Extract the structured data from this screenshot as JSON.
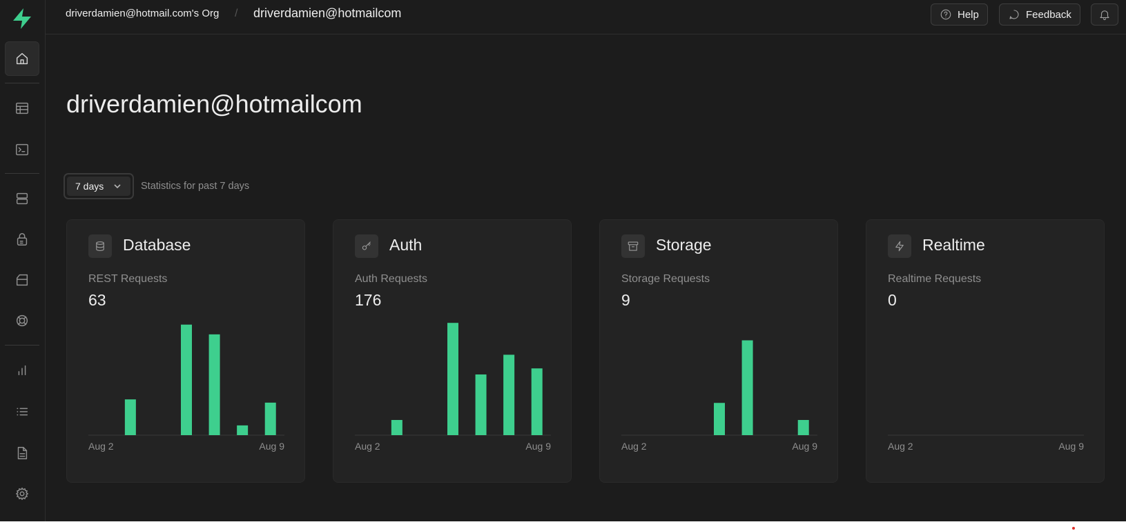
{
  "org": {
    "name": "driverdamien@hotmail.com's Org"
  },
  "project": {
    "name": "driverdamien@hotmailcom"
  },
  "header": {
    "separator": "/",
    "help_label": "Help",
    "feedback_label": "Feedback"
  },
  "sidebar": {
    "items": [
      {
        "name": "home",
        "icon": "home-icon"
      },
      {
        "name": "table-editor",
        "icon": "table-icon"
      },
      {
        "name": "sql-editor",
        "icon": "terminal-icon"
      },
      {
        "name": "database",
        "icon": "database-icon"
      },
      {
        "name": "authentication",
        "icon": "lock-icon"
      },
      {
        "name": "storage",
        "icon": "archive-icon"
      },
      {
        "name": "realtime",
        "icon": "realtime-icon"
      },
      {
        "name": "reports",
        "icon": "bar-chart-icon"
      },
      {
        "name": "logs",
        "icon": "list-icon"
      },
      {
        "name": "api-docs",
        "icon": "document-icon"
      },
      {
        "name": "settings",
        "icon": "gear-icon"
      }
    ]
  },
  "main": {
    "title": "driverdamien@hotmailcom",
    "range": {
      "selected": "7 days",
      "caption": "Statistics for past 7 days"
    },
    "cards": [
      {
        "key": "database",
        "title": "Database",
        "metric_label": "REST Requests",
        "metric_value": "63",
        "icon": "database-icon"
      },
      {
        "key": "auth",
        "title": "Auth",
        "metric_label": "Auth Requests",
        "metric_value": "176",
        "icon": "key-icon"
      },
      {
        "key": "storage",
        "title": "Storage",
        "metric_label": "Storage Requests",
        "metric_value": "9",
        "icon": "archive-icon"
      },
      {
        "key": "realtime",
        "title": "Realtime",
        "metric_label": "Realtime Requests",
        "metric_value": "0",
        "icon": "zap-icon"
      }
    ]
  },
  "colors": {
    "accent": "#3ecf8e",
    "background": "#1c1c1c",
    "card": "#232323"
  },
  "chart_data": [
    {
      "type": "bar",
      "name": "REST Requests",
      "x_start": "Aug 2",
      "x_end": "Aug 9",
      "values": [
        0,
        11,
        0,
        34,
        31,
        3,
        10
      ],
      "ylim": [
        0,
        35
      ]
    },
    {
      "type": "bar",
      "name": "Auth Requests",
      "x_start": "Aug 2",
      "x_end": "Aug 9",
      "values": [
        0,
        10,
        0,
        74,
        40,
        53,
        44
      ],
      "ylim": [
        0,
        75
      ]
    },
    {
      "type": "bar",
      "name": "Storage Requests",
      "x_start": "Aug 2",
      "x_end": "Aug 9",
      "values": [
        0,
        0,
        0,
        1.7,
        5,
        0,
        0.8
      ],
      "ylim": [
        0,
        6
      ]
    },
    {
      "type": "bar",
      "name": "Realtime Requests",
      "x_start": "Aug 2",
      "x_end": "Aug 9",
      "values": [
        0,
        0,
        0,
        0,
        0,
        0,
        0
      ],
      "ylim": [
        0,
        1
      ]
    }
  ]
}
